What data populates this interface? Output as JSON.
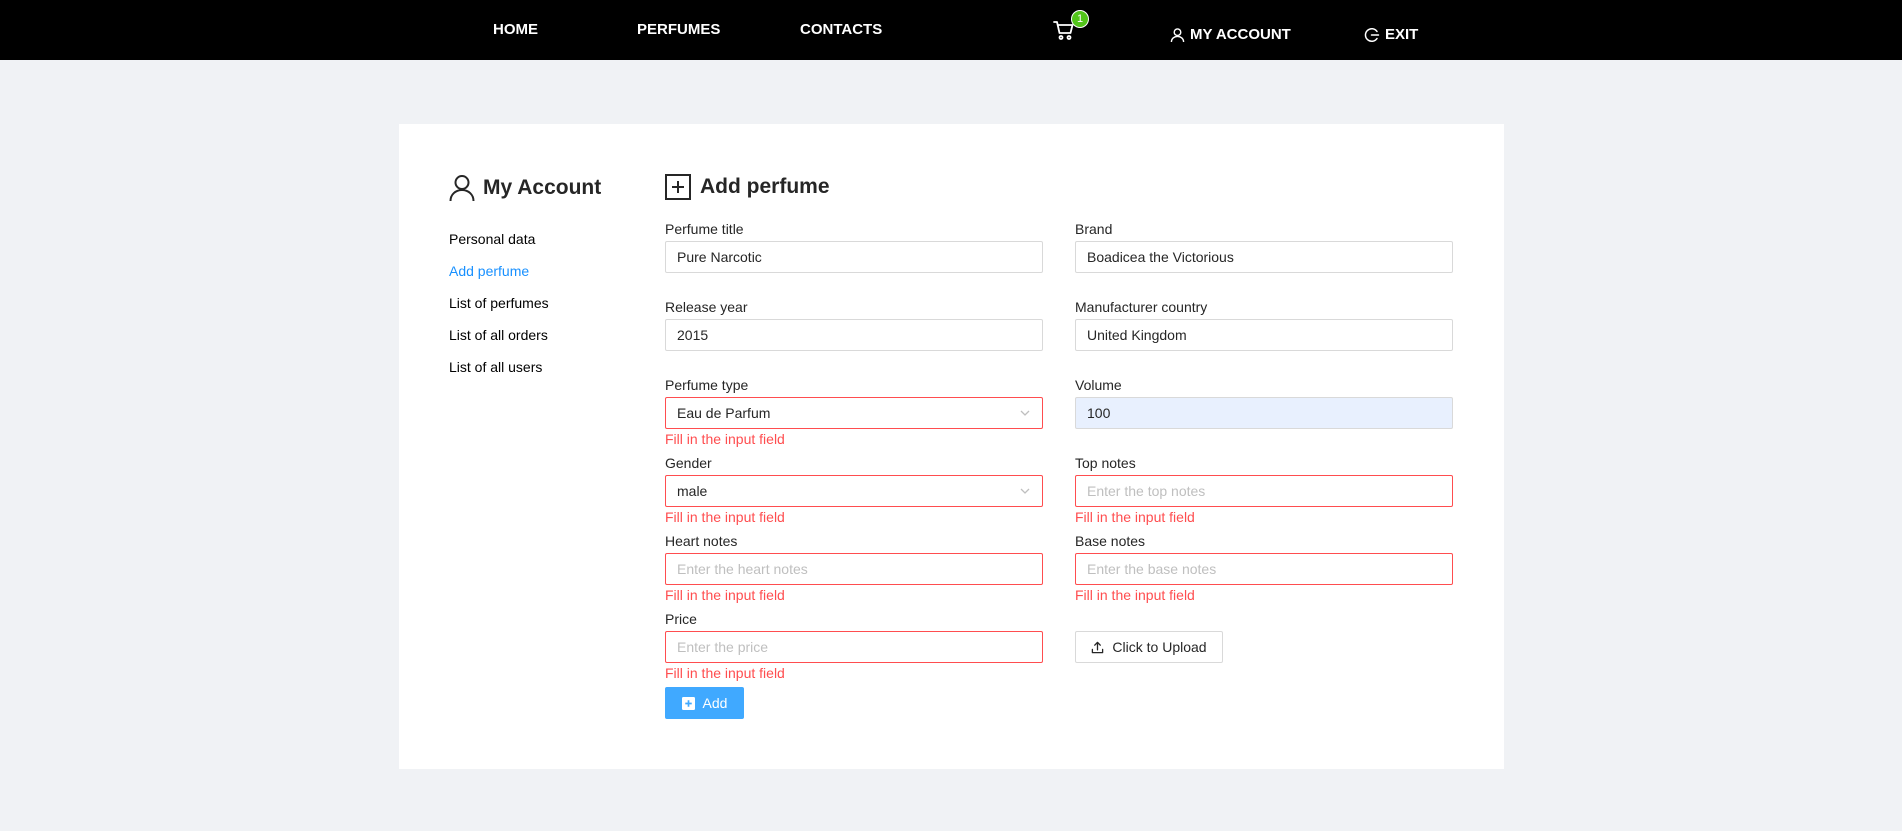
{
  "nav": {
    "home": "HOME",
    "perfumes": "PERFUMES",
    "contacts": "CONTACTS",
    "cart_count": "1",
    "my_account": "MY ACCOUNT",
    "exit": "EXIT"
  },
  "sidebar": {
    "title": "My Account",
    "items": [
      {
        "label": "Personal data"
      },
      {
        "label": "Add perfume",
        "active": true
      },
      {
        "label": "List of perfumes"
      },
      {
        "label": "List of all orders"
      },
      {
        "label": "List of all users"
      }
    ]
  },
  "form": {
    "title": "Add perfume",
    "error_message": "Fill in the input field",
    "perfume_title": {
      "label": "Perfume title",
      "value": "Pure Narcotic"
    },
    "brand": {
      "label": "Brand",
      "value": "Boadicea the Victorious"
    },
    "release_year": {
      "label": "Release year",
      "value": "2015"
    },
    "manufacturer_country": {
      "label": "Manufacturer country",
      "value": "United Kingdom"
    },
    "perfume_type": {
      "label": "Perfume type",
      "value": "Eau de Parfum"
    },
    "volume": {
      "label": "Volume",
      "value": "100"
    },
    "gender": {
      "label": "Gender",
      "value": "male"
    },
    "top_notes": {
      "label": "Top notes",
      "placeholder": "Enter the top notes"
    },
    "heart_notes": {
      "label": "Heart notes",
      "placeholder": "Enter the heart notes"
    },
    "base_notes": {
      "label": "Base notes",
      "placeholder": "Enter the base notes"
    },
    "price": {
      "label": "Price",
      "placeholder": "Enter the price"
    },
    "upload_label": "Click to Upload",
    "add_label": "Add"
  },
  "colors": {
    "topbar": "#000000",
    "accent": "#1890ff",
    "primary_button": "#40a9ff",
    "error": "#ff4d4f",
    "badge": "#52c41a",
    "page_background": "#f0f2f5"
  },
  "icons": [
    "cart-icon",
    "user-icon",
    "exit-icon",
    "plus-square-icon",
    "chevron-down-icon",
    "upload-icon"
  ]
}
